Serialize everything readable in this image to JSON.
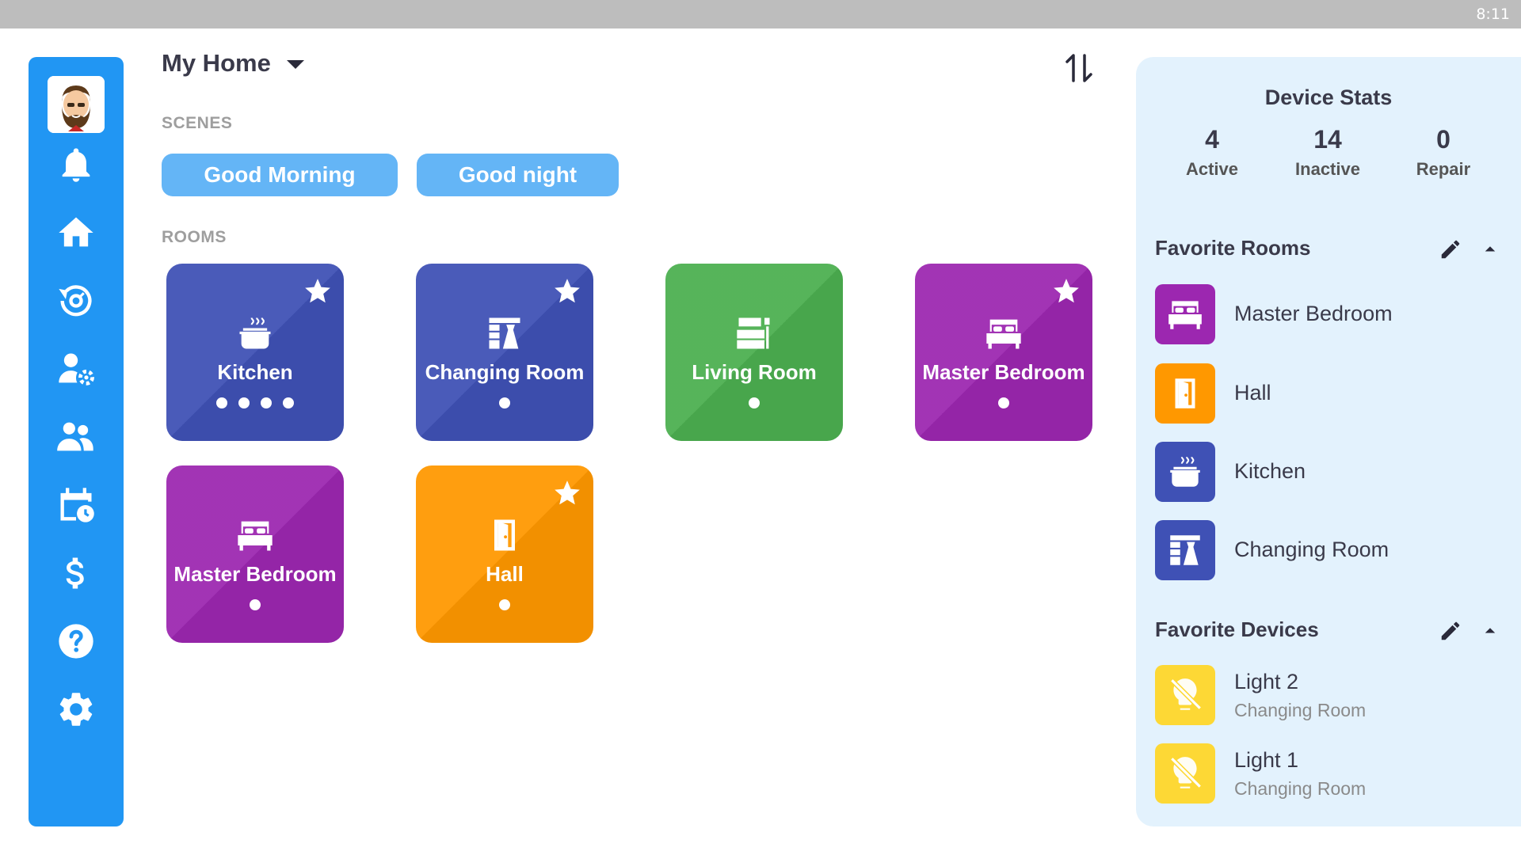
{
  "status_bar": {
    "time": "8:11"
  },
  "sidebar": {
    "items": [
      {
        "name": "notifications",
        "icon": "bell-icon"
      },
      {
        "name": "home",
        "icon": "home-icon"
      },
      {
        "name": "history",
        "icon": "history-icon"
      },
      {
        "name": "user-settings",
        "icon": "user-gear-icon"
      },
      {
        "name": "users",
        "icon": "users-icon"
      },
      {
        "name": "schedule",
        "icon": "calendar-clock-icon"
      },
      {
        "name": "billing",
        "icon": "dollar-icon"
      },
      {
        "name": "help",
        "icon": "help-icon"
      },
      {
        "name": "settings",
        "icon": "gear-icon"
      }
    ]
  },
  "header": {
    "title": "My Home"
  },
  "scenes": {
    "label": "SCENES",
    "items": [
      "Good Morning",
      "Good night"
    ]
  },
  "rooms": {
    "label": "ROOMS",
    "items": [
      {
        "name": "Kitchen",
        "color": "#3f51b5",
        "favorite": true,
        "dots": 4,
        "icon": "pot-icon"
      },
      {
        "name": "Changing Room",
        "color": "#3f51b5",
        "favorite": true,
        "dots": 1,
        "icon": "wardrobe-icon"
      },
      {
        "name": "Living Room",
        "color": "#4caf50",
        "favorite": false,
        "dots": 1,
        "icon": "sofa-icon"
      },
      {
        "name": "Master Bedroom",
        "color": "#9c27b0",
        "favorite": true,
        "dots": 1,
        "icon": "bed-icon"
      },
      {
        "name": "Master Bedroom",
        "color": "#9c27b0",
        "favorite": false,
        "dots": 1,
        "icon": "bed-icon"
      },
      {
        "name": "Hall",
        "color": "#ff9800",
        "favorite": true,
        "dots": 1,
        "icon": "door-icon"
      }
    ]
  },
  "device_stats": {
    "title": "Device Stats",
    "stats": [
      {
        "value": "4",
        "label": "Active"
      },
      {
        "value": "14",
        "label": "Inactive"
      },
      {
        "value": "0",
        "label": "Repair"
      }
    ]
  },
  "favorite_rooms": {
    "title": "Favorite Rooms",
    "items": [
      {
        "name": "Master Bedroom",
        "color": "#9c27b0",
        "icon": "bed-icon"
      },
      {
        "name": "Hall",
        "color": "#ff9800",
        "icon": "door-icon"
      },
      {
        "name": "Kitchen",
        "color": "#3f51b5",
        "icon": "pot-icon"
      },
      {
        "name": "Changing Room",
        "color": "#3f51b5",
        "icon": "wardrobe-icon"
      }
    ]
  },
  "favorite_devices": {
    "title": "Favorite Devices",
    "items": [
      {
        "name": "Light 2",
        "room": "Changing Room",
        "color": "#fdd835",
        "icon": "light-off-icon"
      },
      {
        "name": "Light 1",
        "room": "Changing Room",
        "color": "#fdd835",
        "icon": "light-off-icon"
      }
    ]
  },
  "colors": {
    "sidebar": "#2196f3",
    "scene_button": "#64b5f6",
    "panel_bg": "#e3f2fd"
  }
}
